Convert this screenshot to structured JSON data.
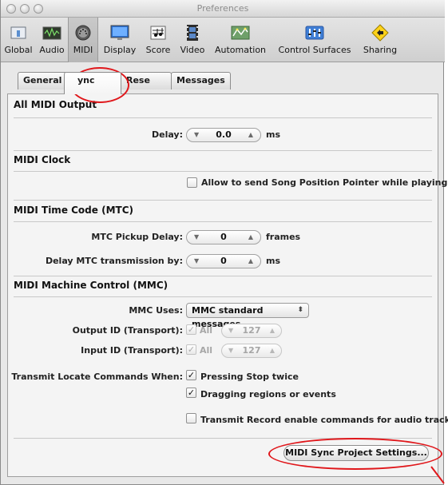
{
  "window": {
    "title": "Preferences"
  },
  "toolbar": {
    "items": [
      {
        "label": "Global",
        "icon": "global-icon"
      },
      {
        "label": "Audio",
        "icon": "audio-icon"
      },
      {
        "label": "MIDI",
        "icon": "midi-icon",
        "selected": true
      },
      {
        "label": "Display",
        "icon": "display-icon"
      },
      {
        "label": "Score",
        "icon": "score-icon"
      },
      {
        "label": "Video",
        "icon": "video-icon"
      },
      {
        "label": "Automation",
        "icon": "automation-icon"
      },
      {
        "label": "Control Surfaces",
        "icon": "control-surfaces-icon"
      },
      {
        "label": "Sharing",
        "icon": "sharing-icon"
      }
    ]
  },
  "tabs": [
    {
      "label": "General"
    },
    {
      "label": "Sync",
      "visible_text": "ync",
      "active": true
    },
    {
      "label": "Reset",
      "visible_text": "Rese"
    },
    {
      "label": "Messages"
    }
  ],
  "sections": {
    "all_midi_output": {
      "title": "All MIDI Output",
      "delay_label": "Delay:",
      "delay_value": "0.0",
      "delay_unit": "ms"
    },
    "midi_clock": {
      "title": "MIDI Clock",
      "spp_label": "Allow to send Song Position Pointer while playing",
      "spp_checked": false
    },
    "mtc": {
      "title": "MIDI Time Code (MTC)",
      "pickup_label": "MTC Pickup Delay:",
      "pickup_value": "0",
      "pickup_unit": "frames",
      "delay_label": "Delay MTC transmission by:",
      "delay_value": "0",
      "delay_unit": "ms"
    },
    "mmc": {
      "title": "MIDI Machine Control (MMC)",
      "uses_label": "MMC Uses:",
      "uses_value": "MMC standard messages",
      "output_label": "Output ID (Transport):",
      "output_all": "All",
      "output_value": "127",
      "input_label": "Input ID (Transport):",
      "input_all": "All",
      "input_value": "127",
      "transmit_label": "Transmit Locate Commands When:",
      "stop_twice_label": "Pressing Stop twice",
      "stop_twice_checked": true,
      "dragging_label": "Dragging regions or events",
      "dragging_checked": true,
      "record_enable_label": "Transmit Record enable commands for audio tracks",
      "record_enable_checked": false
    }
  },
  "footer": {
    "button_label": "MIDI Sync Project Settings..."
  },
  "annotation_color": "#e0171b"
}
